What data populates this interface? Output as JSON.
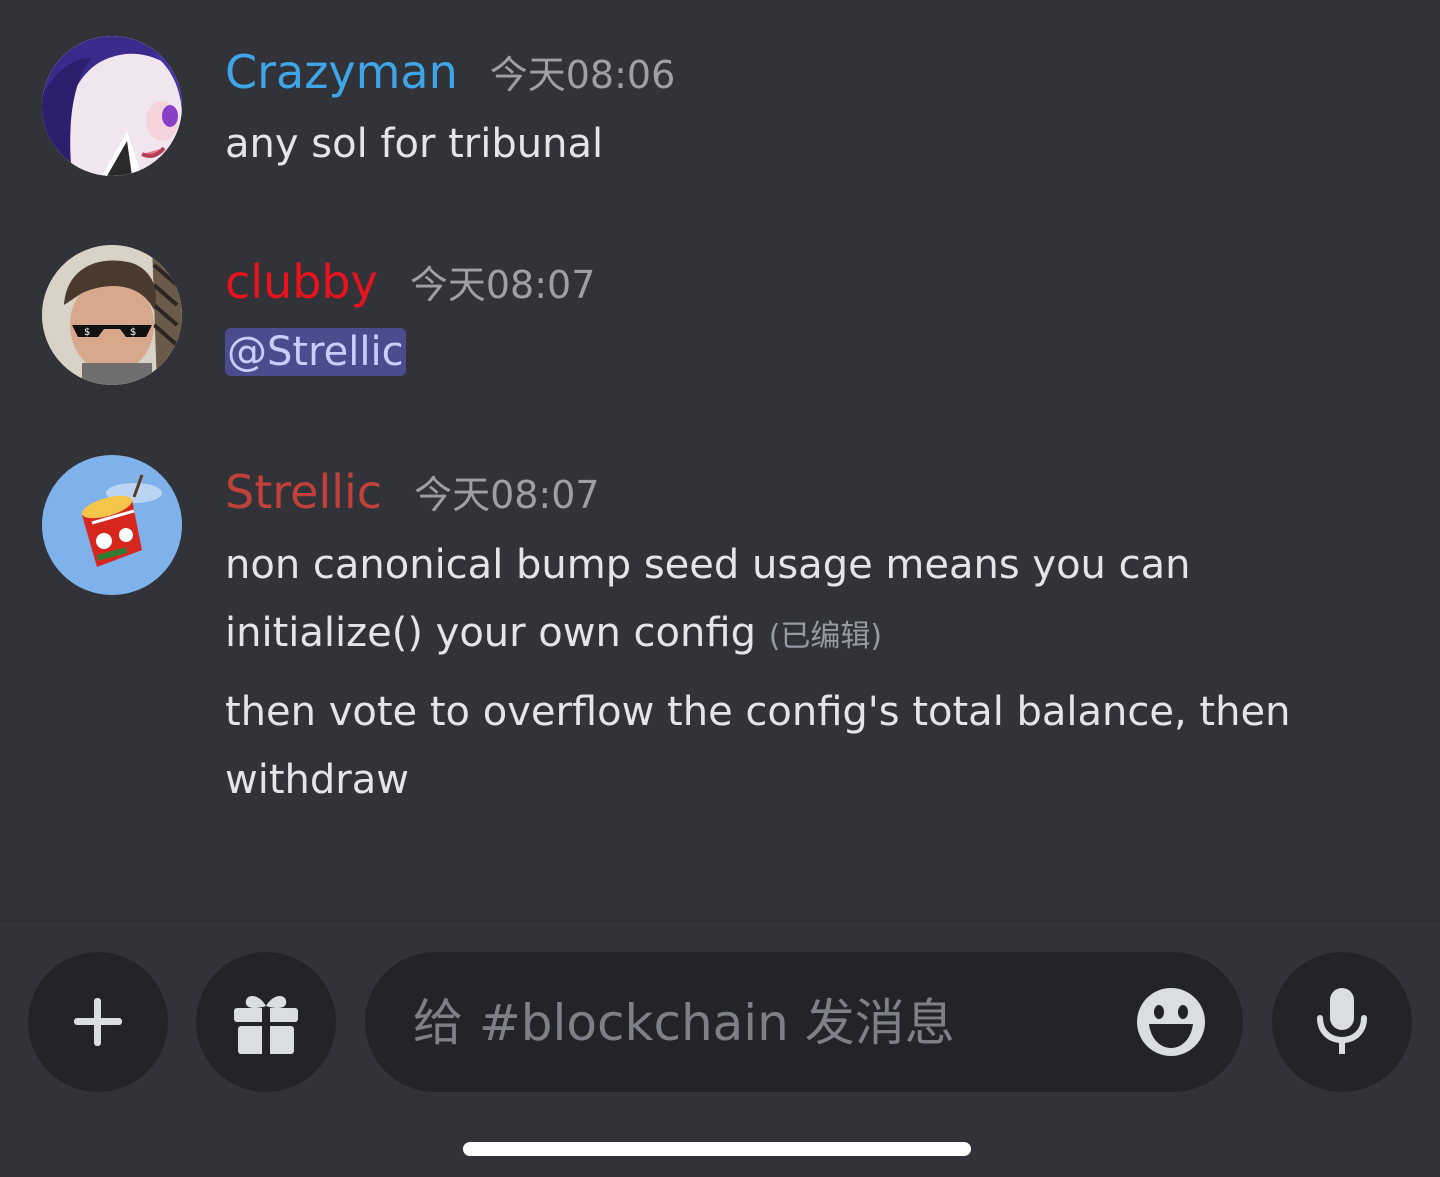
{
  "messages": [
    {
      "username": "Crazyman",
      "username_color": "#3ea5e8",
      "time": "今天08:06",
      "lines": [
        "any sol for tribunal"
      ],
      "avatar": "anime-girl-avatar"
    },
    {
      "username": "clubby",
      "username_color": "#e8131c",
      "time": "今天08:07",
      "mention": "@Strellic",
      "avatar": "sunglasses-man-avatar"
    },
    {
      "username": "Strellic",
      "username_color": "#c2403a",
      "time": "今天08:07",
      "line1": "non canonical bump seed usage means you can",
      "line2": "initialize() your own config",
      "edited": "(已编辑)",
      "line3": "then vote to overflow the config's total balance, then",
      "line4": "withdraw",
      "avatar": "noodle-cup-avatar"
    }
  ],
  "composer": {
    "placeholder": "给 #blockchain 发消息",
    "add_icon": "plus-icon",
    "gift_icon": "gift-icon",
    "emoji_icon": "emoji-icon",
    "mic_icon": "microphone-icon"
  }
}
